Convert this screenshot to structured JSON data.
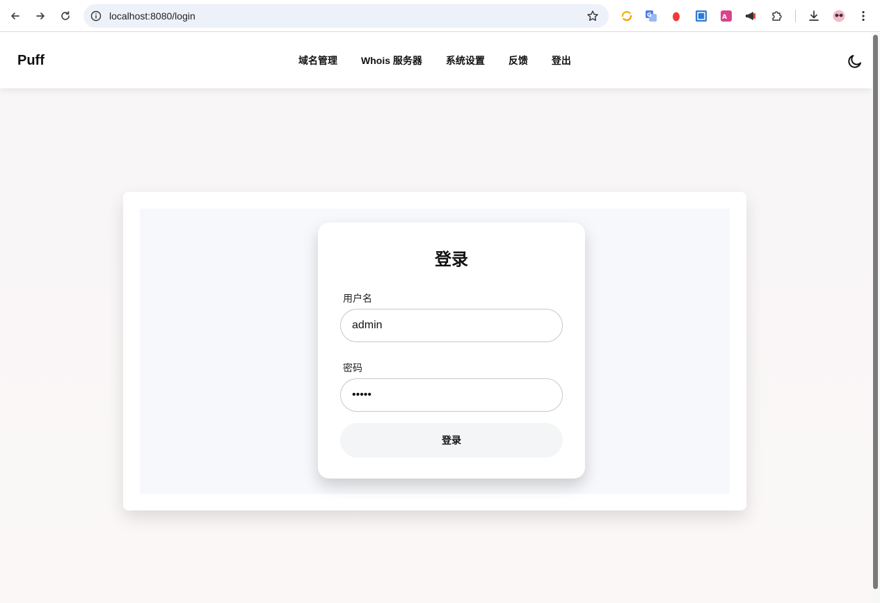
{
  "browser": {
    "url": "localhost:8080/login"
  },
  "header": {
    "brand": "Puff",
    "nav": [
      {
        "label": "域名管理"
      },
      {
        "label": "Whois 服务器"
      },
      {
        "label": "系统设置"
      },
      {
        "label": "反馈"
      },
      {
        "label": "登出"
      }
    ]
  },
  "login": {
    "title": "登录",
    "username_label": "用户名",
    "username_value": "admin",
    "password_label": "密码",
    "password_value": "•••••",
    "submit_label": "登录"
  },
  "colors": {
    "page_bg": "#f8f6f7",
    "panel_bg": "#f7f8fb",
    "omnibox_bg": "#edf1fa",
    "button_bg": "#f4f5f7"
  }
}
